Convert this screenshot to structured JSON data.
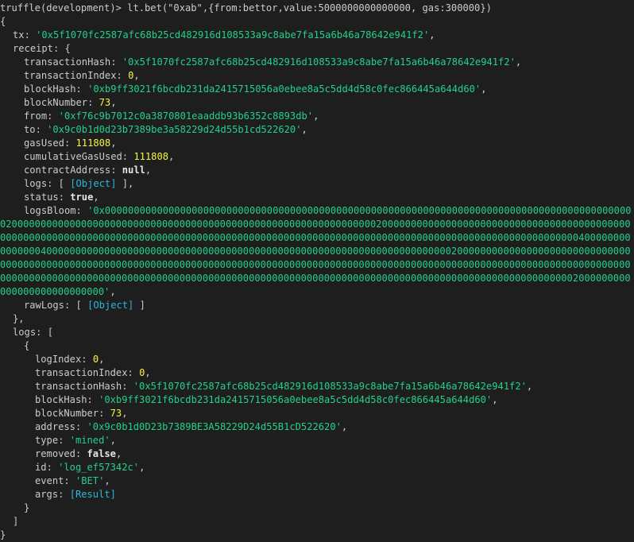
{
  "prompt": "truffle(development)> lt.bet(\"0xab\",{from:bettor,value:5000000000000000, gas:300000})",
  "open_brace": "{",
  "close_brace": "}",
  "tx": {
    "key": "tx",
    "value": "'0x5f1070fc2587afc68b25cd482916d108533a9c8abe7fa15a6b46a78642e941f2'"
  },
  "receipt": {
    "key": "receipt",
    "open": "{",
    "close": "},",
    "transactionHash": "'0x5f1070fc2587afc68b25cd482916d108533a9c8abe7fa15a6b46a78642e941f2'",
    "transactionIndex": "0",
    "blockHash": "'0xb9ff3021f6bcdb231da2415715056a0ebee8a5c5dd4d58c0fec866445a644d60'",
    "blockNumber": "73",
    "from": "'0xf76c9b7012c0a3870801eaaddb93b6352c8893db'",
    "to": "'0x9c0b1d0d23b7389be3a58229d24d55b1cd522620'",
    "gasUsed": "111808",
    "cumulativeGasUsed": "111808",
    "contractAddress": "null",
    "logs_tag": "[Object]",
    "status": "true",
    "logsBloom": "'0x000000000000000000000000000000000000000000000000000000000000000000000000000000000000000000002000000000000000000000000000000000000000000000000000000000000000200000000000000000000000000000000000000000000000000000000000000000000000000000000000000000000000000000000000000000000000000000000000000000000000400000000000000040000000000000000000000000000000000000000000000000000000000000000000000200000000000000000000000000000000000000000000000000000000000000000000000000000000000000000000000000000000000000000000000000000000000000000000000000000000000000000000000000000000000000000000000000000000000000000000000000000000000000000000002000000000000000000000000000'",
    "rawLogs_tag": "[Object]"
  },
  "logs": {
    "key": "logs",
    "open": "[",
    "close": "]",
    "item_open": "{",
    "item_close": "}",
    "logIndex": "0",
    "transactionIndex": "0",
    "transactionHash": "'0x5f1070fc2587afc68b25cd482916d108533a9c8abe7fa15a6b46a78642e941f2'",
    "blockHash": "'0xb9ff3021f6bcdb231da2415715056a0ebee8a5c5dd4d58c0fec866445a644d60'",
    "blockNumber": "73",
    "address": "'0x9c0b1d0D23b7389BE3A58229D24d55B1cD522620'",
    "type": "'mined'",
    "removed": "false",
    "id": "'log_ef57342c'",
    "event": "'BET'",
    "args_tag": "[Result]"
  },
  "colors": {
    "background": "#1e1e1e",
    "string": "#23d18b",
    "number": "#f5f543",
    "keyword": "#e5e5e5",
    "tag": "#29b8db",
    "text": "#cccccc"
  }
}
